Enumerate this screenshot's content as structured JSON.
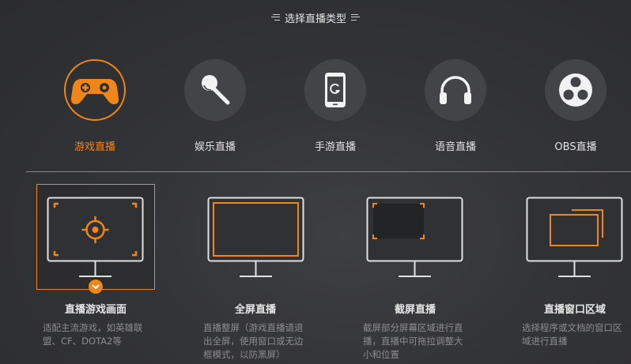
{
  "header": {
    "title": "选择直播类型"
  },
  "live_types": [
    {
      "label": "游戏直播",
      "icon": "gamepad-icon",
      "active": true
    },
    {
      "label": "娱乐直播",
      "icon": "microphone-icon",
      "active": false
    },
    {
      "label": "手游直播",
      "icon": "mobile-phone-icon",
      "active": false
    },
    {
      "label": "语音直播",
      "icon": "headphones-icon",
      "active": false
    },
    {
      "label": "OBS直播",
      "icon": "obs-logo-icon",
      "active": false
    }
  ],
  "capture_modes": [
    {
      "name": "直播游戏画面",
      "desc": [
        "适配主流游戏，如英雄联",
        "盟、CF、DOTA2等"
      ],
      "icon": "crosshair-monitor-icon",
      "active": true
    },
    {
      "name": "全屏直播",
      "desc": [
        "直播整屏（游戏直播请退",
        "出全屏，使用窗口或无边",
        "框模式，以防黑屏）"
      ],
      "icon": "fullscreen-monitor-icon",
      "active": false
    },
    {
      "name": "截屏直播",
      "desc": [
        "截屏部分屏幕区域进行直",
        "播，直播中可拖拉调整大",
        "小和位置"
      ],
      "icon": "region-monitor-icon",
      "active": false
    },
    {
      "name": "直播窗口区域",
      "desc": [
        "选择程序或文档的窗口区",
        "域进行直播"
      ],
      "icon": "window-monitor-icon",
      "active": false
    }
  ],
  "colors": {
    "accent": "#f08619",
    "background": "#333438",
    "circle": "#434448"
  }
}
